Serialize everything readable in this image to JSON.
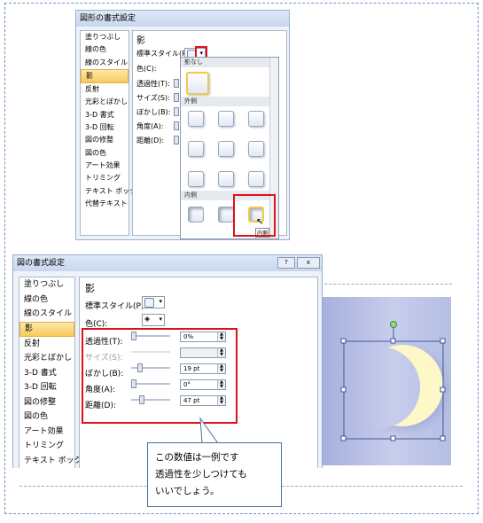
{
  "top_dialog": {
    "title": "図形の書式設定",
    "categories": [
      "塗りつぶし",
      "線の色",
      "線のスタイル",
      "影",
      "反射",
      "光彩とぼかし",
      "3-D 書式",
      "3-D 回転",
      "図の修整",
      "図の色",
      "アート効果",
      "トリミング",
      "テキスト ボックス",
      "代替テキスト"
    ],
    "selected_category": "影",
    "section_heading": "影",
    "labels": {
      "preset": "標準スタイル(P):",
      "color": "色(C):",
      "transparency": "透過性(T):",
      "size": "サイズ(S):",
      "blur": "ぼかし(B):",
      "angle": "角度(A):",
      "distance": "距離(D):"
    },
    "shadow_gallery": {
      "group_none": "影なし",
      "group_outer": "外側",
      "group_inner": "内側",
      "tooltip": "内側",
      "tooltip_cut": "内側の..."
    }
  },
  "bottom_dialog": {
    "title": "図の書式設定",
    "title_buttons": [
      "?",
      "x"
    ],
    "categories": [
      "塗りつぶし",
      "線の色",
      "線のスタイル",
      "影",
      "反射",
      "光彩とぼかし",
      "3-D 書式",
      "3-D 回転",
      "図の修整",
      "図の色",
      "アート効果",
      "トリミング",
      "テキスト ボックス"
    ],
    "selected_category": "影",
    "section_heading": "影",
    "labels": {
      "preset": "標準スタイル(P):",
      "color": "色(C):",
      "transparency": "透過性(T):",
      "size": "サイズ(S):",
      "blur": "ぼかし(B):",
      "angle": "角度(A):",
      "distance": "距離(D):"
    },
    "values": {
      "transparency": "0%",
      "size": "",
      "blur": "19 pt",
      "angle": "0°",
      "distance": "47 pt"
    },
    "slider_levels": {
      "transparency": 0.0,
      "blur": 0.19,
      "angle": 0.0,
      "distance": 0.24
    }
  },
  "callout": {
    "lines": [
      "この数値は一例です",
      "透過性を少しつけても",
      "いいでしょう。"
    ]
  },
  "colors": {
    "highlight": "#e0101a",
    "selected_category": "#f8c95c",
    "moon": "#fdf8c8",
    "sky": "#b5bee4"
  }
}
